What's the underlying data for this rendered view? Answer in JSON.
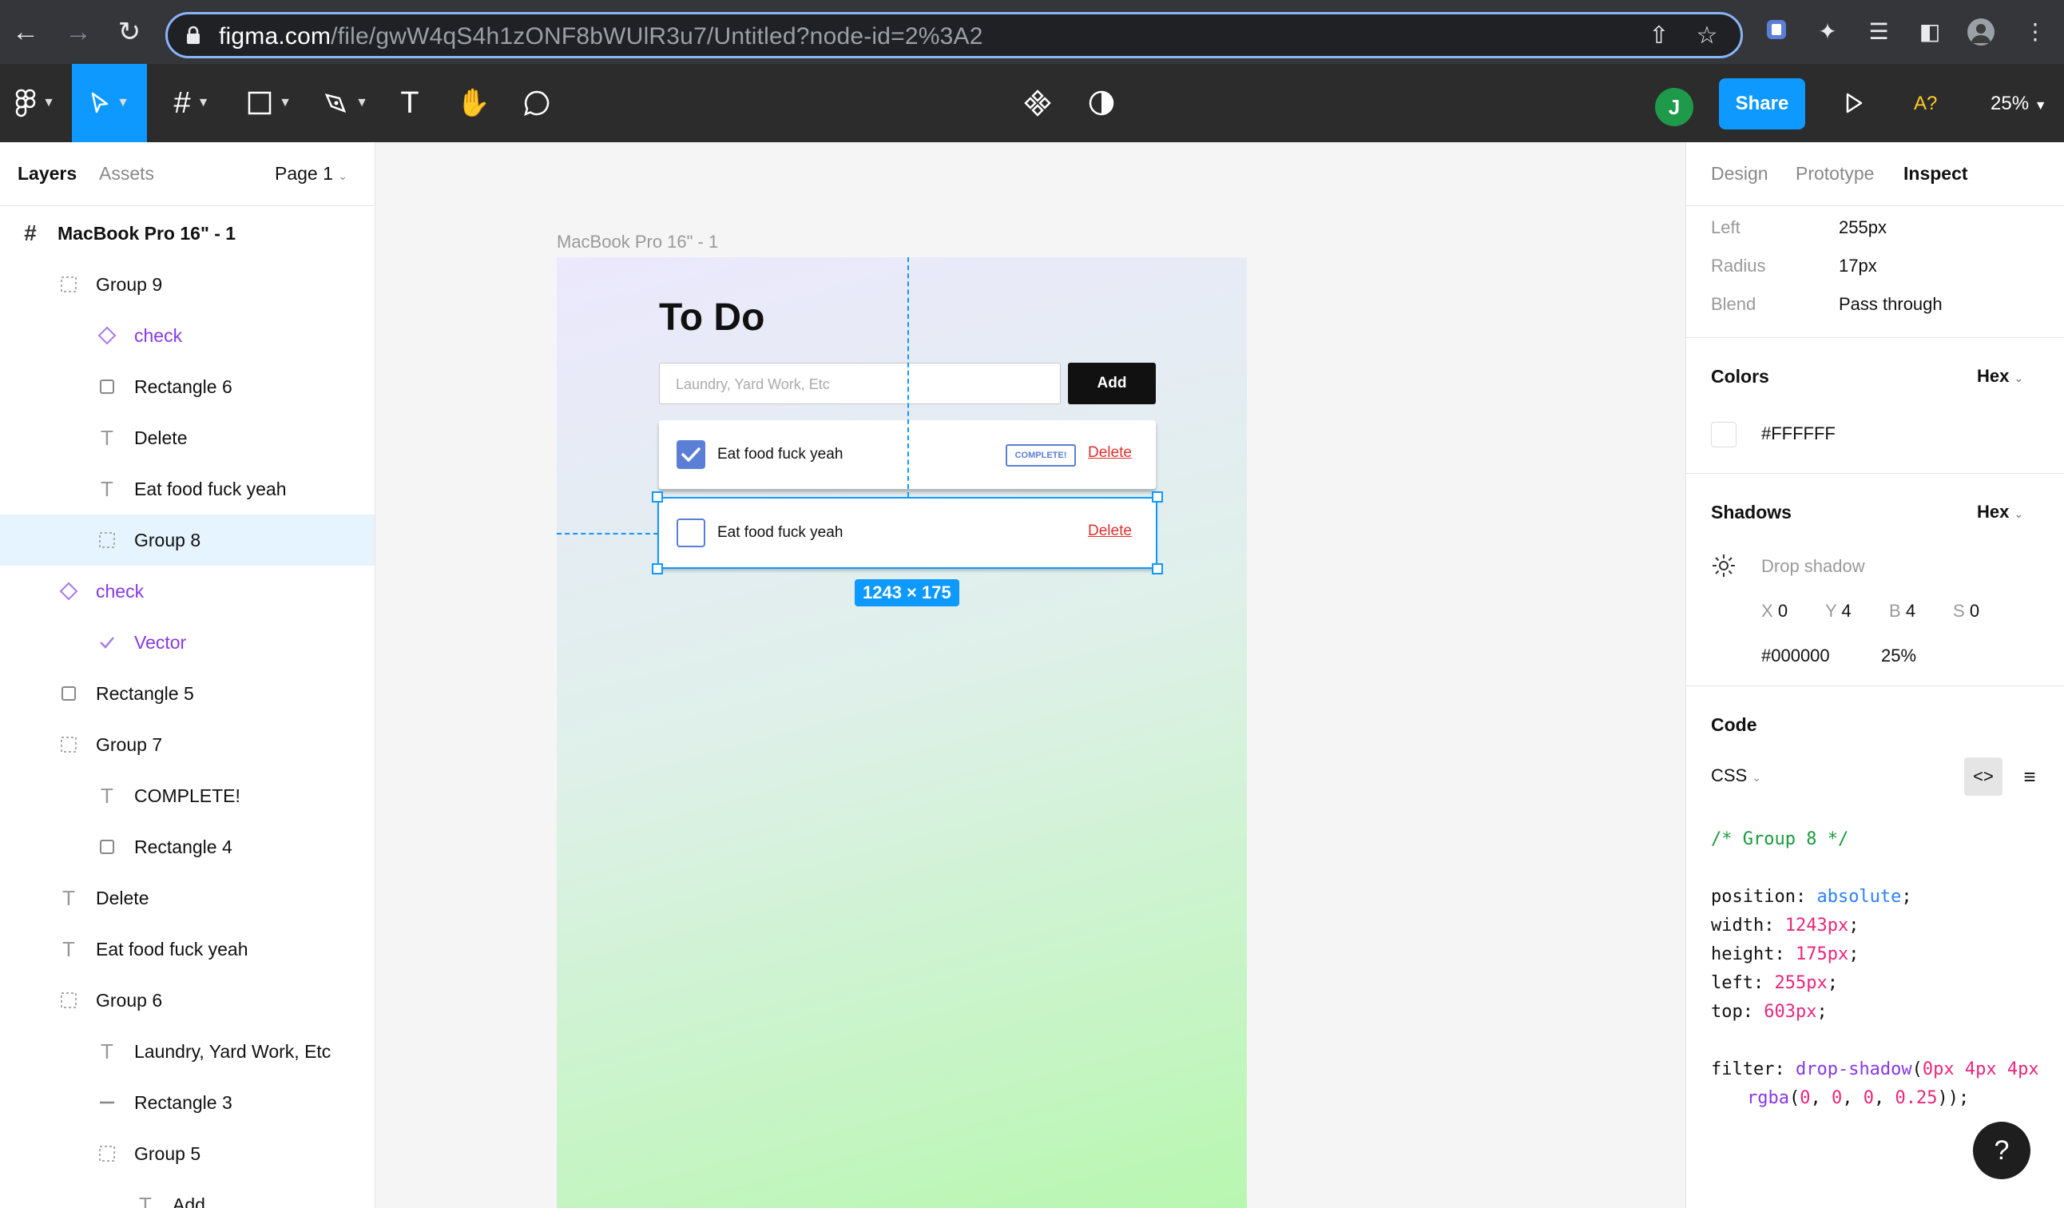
{
  "browser": {
    "url_host": "figma.com",
    "url_path": "/file/gwW4qS4h1zONF8bWUlR3u7/Untitled?node-id=2%3A2"
  },
  "toolbar": {
    "share_label": "Share",
    "avatar_initial": "J",
    "font_warning": "A?",
    "zoom": "25%"
  },
  "left_panel": {
    "tabs": [
      "Layers",
      "Assets"
    ],
    "page": "Page 1",
    "frame_name": "MacBook Pro 16\" - 1",
    "layers": [
      {
        "name": "Group 9",
        "icon": "group-icon",
        "indent": 1
      },
      {
        "name": "check",
        "icon": "component-icon",
        "indent": 2,
        "purple": true
      },
      {
        "name": "Rectangle 6",
        "icon": "rectangle-icon",
        "indent": 2
      },
      {
        "name": "Delete",
        "icon": "text-icon",
        "indent": 2
      },
      {
        "name": "Eat food fuck yeah",
        "icon": "text-icon",
        "indent": 2
      },
      {
        "name": "Group 8",
        "icon": "group-icon",
        "indent": 2,
        "selected": true
      },
      {
        "name": "check",
        "icon": "component-icon",
        "indent": 1,
        "purple": true
      },
      {
        "name": "Vector",
        "icon": "vector-icon",
        "indent": 2,
        "purple": true
      },
      {
        "name": "Rectangle 5",
        "icon": "rectangle-icon",
        "indent": 1
      },
      {
        "name": "Group 7",
        "icon": "group-icon",
        "indent": 1
      },
      {
        "name": "COMPLETE!",
        "icon": "text-icon",
        "indent": 2
      },
      {
        "name": "Rectangle 4",
        "icon": "rectangle-icon",
        "indent": 2
      },
      {
        "name": "Delete",
        "icon": "text-icon",
        "indent": 1
      },
      {
        "name": "Eat food fuck yeah",
        "icon": "text-icon",
        "indent": 1
      },
      {
        "name": "Group 6",
        "icon": "group-icon",
        "indent": 1
      },
      {
        "name": "Laundry, Yard Work, Etc",
        "icon": "text-icon",
        "indent": 2
      },
      {
        "name": "Rectangle 3",
        "icon": "line-icon",
        "indent": 2
      },
      {
        "name": "Group 5",
        "icon": "group-icon",
        "indent": 2
      },
      {
        "name": "Add",
        "icon": "text-icon",
        "indent": 3
      }
    ]
  },
  "canvas": {
    "frame_label": "MacBook Pro 16\" - 1",
    "title": "To Do",
    "input_placeholder": "Laundry, Yard Work, Etc",
    "add_label": "Add",
    "items": [
      {
        "text": "Eat food fuck yeah",
        "checked": true,
        "badge": "COMPLETE!",
        "delete": "Delete"
      },
      {
        "text": "Eat food fuck yeah",
        "checked": false,
        "badge": "",
        "delete": "Delete"
      }
    ],
    "size_tag": "1243 × 175"
  },
  "right_panel": {
    "tabs": [
      "Design",
      "Prototype",
      "Inspect"
    ],
    "props": [
      {
        "label": "Left",
        "value": "255px"
      },
      {
        "label": "Radius",
        "value": "17px"
      },
      {
        "label": "Blend",
        "value": "Pass through"
      }
    ],
    "colors": {
      "title": "Colors",
      "format": "Hex",
      "value": "#FFFFFF",
      "swatch": "#FFFFFF"
    },
    "shadows": {
      "title": "Shadows",
      "format": "Hex",
      "type": "Drop shadow",
      "x_label": "X",
      "x": "0",
      "y_label": "Y",
      "y": "4",
      "b_label": "B",
      "b": "4",
      "s_label": "S",
      "s": "0",
      "color": "#000000",
      "opacity": "25%"
    },
    "code": {
      "title": "Code",
      "lang": "CSS",
      "comment": "/* Group 8 */",
      "position_prop": "position: ",
      "position_val": "absolute",
      "width_prop": "width: ",
      "width_val": "1243px",
      "height_prop": "height: ",
      "height_val": "175px",
      "left_prop": "left: ",
      "left_val": "255px",
      "top_prop": "top: ",
      "top_val": "603px",
      "filter_prop": "filter: ",
      "filter_fn": "drop-shadow",
      "filter_args": "0px 4px 4px",
      "rgba_fn": "rgba",
      "rgba_r": "0",
      "rgba_g": "0",
      "rgba_b": "0",
      "rgba_a": "0.25"
    },
    "help_label": "?"
  }
}
